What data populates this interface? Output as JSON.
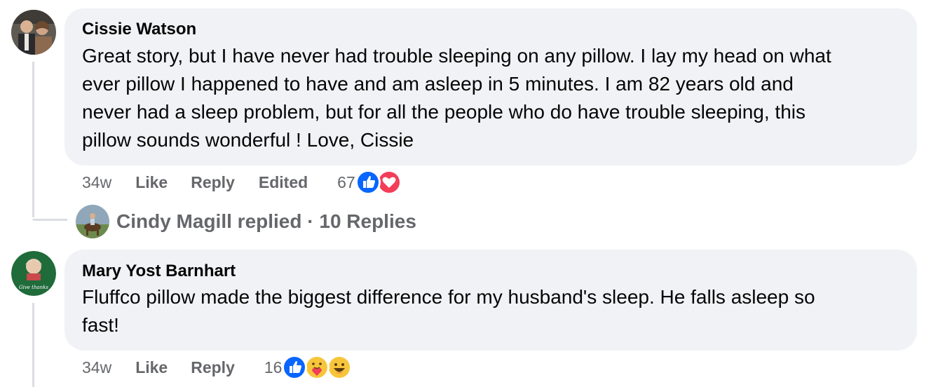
{
  "comments": [
    {
      "author": "Cissie Watson",
      "lines": [
        "Great story, but I have never had trouble sleeping on any pillow. I lay my head on what",
        "ever pillow I happened to have and am asleep in 5 minutes. I am 82 years old and",
        "never had a sleep problem, but for all the people who do have trouble sleeping, this",
        "pillow sounds wonderful ! Love, Cissie"
      ],
      "time": "34w",
      "like_label": "Like",
      "reply_label": "Reply",
      "edited_label": "Edited",
      "reaction_count": "67",
      "reactions": [
        "like-icon",
        "love-icon"
      ],
      "replies_preview": {
        "text": "Cindy Magill replied · 10 Replies"
      }
    },
    {
      "author": "Mary Yost Barnhart",
      "avatar_text": "Give thanks",
      "lines": [
        "Fluffco pillow made the biggest difference for my husband's sleep. He falls asleep so",
        "fast!"
      ],
      "time": "34w",
      "like_label": "Like",
      "reply_label": "Reply",
      "reaction_count": "16",
      "reactions": [
        "like-icon",
        "care-icon",
        "haha-icon"
      ]
    }
  ],
  "colors": {
    "bubble": "#f0f2f5",
    "meta_text": "#65676b",
    "like_blue": "#0866ff",
    "love_red": "#f33e58",
    "thread_line": "#dadde1"
  }
}
